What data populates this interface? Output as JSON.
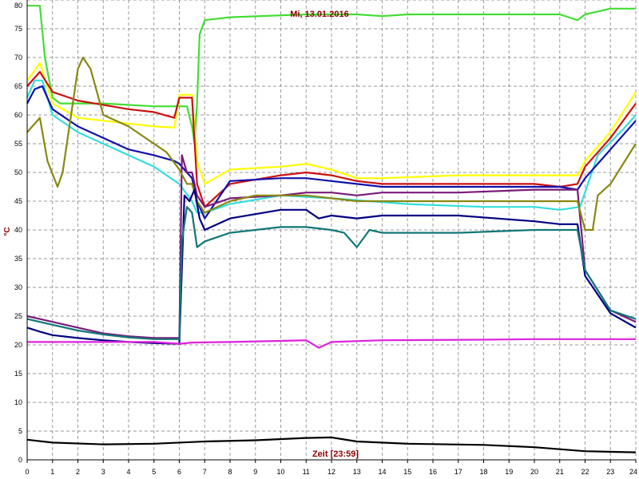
{
  "chart_data": {
    "type": "line",
    "title": "Mi, 13.01.2016",
    "xlabel": "Zeit [23:59]",
    "ylabel": "°C",
    "xlim": [
      0,
      24
    ],
    "ylim": [
      0,
      80
    ],
    "x_ticks": [
      "0",
      "1",
      "2",
      "3",
      "4",
      "5",
      "6",
      "7",
      "8",
      "9",
      "10",
      "11",
      "12",
      "13",
      "14",
      "15",
      "16",
      "17",
      "18",
      "19",
      "20",
      "21",
      "22",
      "23",
      "24"
    ],
    "y_ticks": [
      "0",
      "5",
      "10",
      "15",
      "20",
      "25",
      "30",
      "35",
      "40",
      "45",
      "50",
      "55",
      "60",
      "65",
      "70",
      "75",
      "80"
    ],
    "grid": true,
    "series": [
      {
        "color": "#44dd33",
        "x": [
          0,
          0.5,
          0.7,
          1,
          1.3,
          1.6,
          2,
          3,
          5,
          6,
          6.3,
          6.5,
          6.6,
          6.7,
          6.8,
          7,
          8,
          11,
          13,
          14,
          15,
          21,
          21.7,
          22,
          23,
          24
        ],
        "y": [
          79,
          79,
          70,
          63,
          62,
          62,
          62,
          62,
          61.5,
          61.5,
          61.5,
          58,
          55,
          62,
          74,
          76.5,
          77,
          77.5,
          77.5,
          77.2,
          77.5,
          77.5,
          76.5,
          77.5,
          78.5,
          78.5
        ]
      },
      {
        "color": "#ffff00",
        "x": [
          0,
          0.5,
          1,
          2,
          4,
          5,
          5.8,
          6,
          6.5,
          6.7,
          7,
          8,
          10,
          11,
          12,
          13,
          14,
          17,
          20,
          21,
          21.7,
          22,
          23,
          24
        ],
        "y": [
          66,
          69,
          62,
          59.5,
          58.5,
          58,
          57.8,
          63.5,
          63.5,
          52,
          48,
          50.5,
          51,
          51.5,
          50.5,
          49,
          49,
          49.5,
          49.5,
          49.5,
          49.5,
          52,
          57,
          64
        ]
      },
      {
        "color": "#cc1111",
        "x": [
          0,
          0.5,
          1,
          2,
          4,
          5,
          5.8,
          6,
          6.5,
          6.7,
          7,
          8,
          10,
          11,
          12,
          13,
          14,
          17,
          20,
          21,
          21.7,
          22,
          23,
          24
        ],
        "y": [
          65,
          67.5,
          64,
          62.5,
          61,
          60.5,
          59.5,
          63,
          63,
          48,
          44,
          48,
          49.5,
          50,
          49.5,
          48.5,
          48,
          48,
          48,
          47.5,
          48,
          51,
          56,
          62
        ]
      },
      {
        "color": "#33dddd",
        "x": [
          0,
          0.3,
          0.6,
          1,
          2,
          3,
          4,
          5,
          6,
          6.5,
          6.7,
          7,
          8,
          10,
          12,
          15,
          18,
          20,
          21,
          21.8,
          22.5,
          23.5,
          24
        ],
        "y": [
          63,
          66,
          66,
          60,
          57,
          55,
          53,
          51,
          48,
          45,
          43,
          43,
          44.5,
          46,
          45.5,
          44.5,
          44,
          44,
          43.5,
          44,
          53,
          57.5,
          60
        ]
      },
      {
        "color": "#1111aa",
        "x": [
          0,
          0.3,
          0.6,
          1,
          2,
          3,
          4,
          5,
          5.8,
          6,
          6.3,
          6.5,
          6.7,
          7,
          8,
          10,
          11,
          12,
          13,
          14,
          17,
          20,
          21,
          21.7,
          22,
          23,
          24
        ],
        "y": [
          62,
          64.5,
          65,
          61,
          58,
          56,
          54,
          53,
          52,
          51.5,
          50,
          49,
          45,
          42,
          48.5,
          49,
          49,
          48.5,
          48,
          47.5,
          47.5,
          47.5,
          47.5,
          47,
          49,
          54,
          59
        ]
      },
      {
        "color": "#7a1a7a",
        "x": [
          0,
          0.5,
          1,
          2,
          3,
          4,
          5,
          6,
          6.1,
          6.3,
          6.5,
          6.7,
          7,
          8,
          10,
          11,
          12,
          13,
          14,
          17,
          20,
          21,
          21.7,
          22,
          23,
          24
        ],
        "y": [
          25,
          24.5,
          24,
          23,
          22,
          21.5,
          21.2,
          21.2,
          53,
          50,
          50,
          46,
          44,
          45.5,
          46,
          46.5,
          46.5,
          46,
          46.5,
          46.5,
          47,
          47,
          47,
          33,
          26,
          24
        ]
      },
      {
        "color": "#888811",
        "x": [
          0,
          0.5,
          0.8,
          1.2,
          1.4,
          2,
          2.2,
          2.5,
          3,
          4,
          5,
          5.5,
          6,
          6.3,
          6.5,
          6.7,
          7,
          8,
          9,
          10,
          11,
          12,
          13,
          14,
          17,
          20,
          21,
          21.7,
          22,
          22.3,
          22.5,
          23,
          24
        ],
        "y": [
          57,
          59.5,
          52,
          47.5,
          50,
          68,
          70,
          68,
          60,
          58,
          55,
          53.5,
          50.5,
          48,
          48,
          45,
          43,
          45,
          46,
          46,
          46,
          45.5,
          45,
          45,
          45,
          45,
          45,
          45,
          40,
          40,
          46,
          48,
          55
        ]
      },
      {
        "color": "#000080",
        "x": [
          0,
          0.5,
          1,
          2,
          3,
          4,
          5,
          6,
          6.2,
          6.4,
          6.6,
          6.8,
          7,
          8,
          10,
          11,
          11.5,
          12,
          13,
          14,
          17,
          20,
          21,
          21.7,
          22,
          23,
          24
        ],
        "y": [
          23,
          22.3,
          21.7,
          21.2,
          20.8,
          20.5,
          20.3,
          20.2,
          46,
          45,
          47,
          42,
          40,
          42,
          43.5,
          43.5,
          42,
          42.5,
          42,
          42.5,
          42.5,
          41.5,
          41,
          41,
          32,
          25.5,
          23
        ]
      },
      {
        "color": "#117777",
        "x": [
          0,
          0.5,
          1,
          2,
          3,
          4,
          5,
          6,
          6.1,
          6.3,
          6.5,
          6.7,
          7,
          8,
          10,
          11,
          12,
          12.5,
          13,
          13.5,
          14,
          17,
          20,
          21,
          21.7,
          22,
          23,
          24
        ],
        "y": [
          24.5,
          24,
          23.5,
          22.5,
          21.8,
          21.3,
          21,
          21,
          38,
          44,
          43,
          37,
          38,
          39.5,
          40.5,
          40.5,
          40,
          39.5,
          37,
          40,
          39.5,
          39.5,
          40,
          40,
          40,
          33,
          26,
          24.5
        ]
      },
      {
        "color": "#dd22dd",
        "x": [
          0,
          5,
          6,
          6.5,
          8,
          10,
          11,
          11.5,
          12,
          14,
          18,
          20,
          24
        ],
        "y": [
          20.5,
          20.5,
          20.2,
          20.4,
          20.5,
          20.7,
          20.8,
          19.5,
          20.5,
          20.8,
          20.9,
          21,
          21
        ]
      },
      {
        "color": "#000000",
        "x": [
          0,
          1,
          3,
          5,
          7,
          9,
          11,
          12,
          13,
          15,
          18,
          20,
          22,
          24
        ],
        "y": [
          3.5,
          3,
          2.7,
          2.8,
          3.2,
          3.4,
          3.8,
          3.9,
          3.2,
          2.8,
          2.6,
          2.2,
          1.5,
          1.3
        ]
      }
    ]
  }
}
